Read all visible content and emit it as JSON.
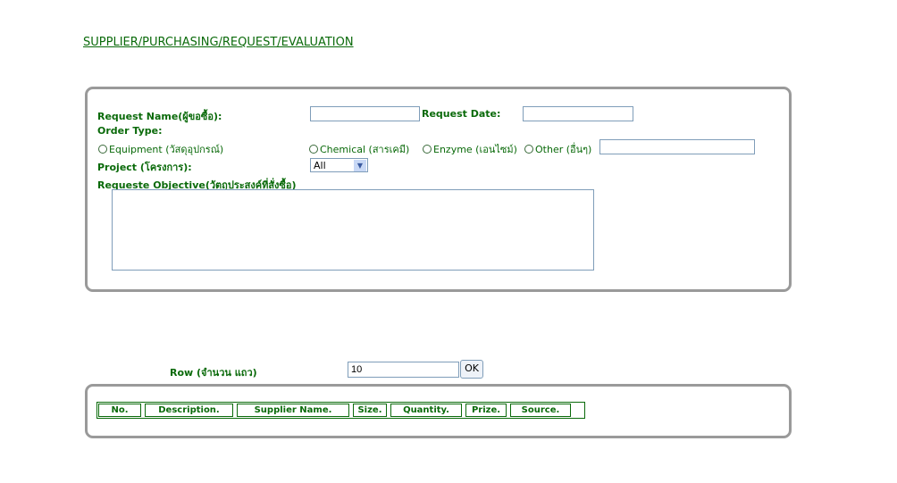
{
  "title": "SUPPLIER/PURCHASING/REQUEST/EVALUATION",
  "form": {
    "request_name_label": "Request Name(ผู้ขอซื้อ):",
    "request_name_value": "",
    "request_date_label": "Request Date:",
    "request_date_value": "",
    "order_type_label": "Order Type:",
    "order_types": [
      "Equipment (วัสดุอุปกรณ์)",
      "Chemical (สารเคมี)",
      "Enzyme (เอนไซม์)",
      "Other (อื่นๆ)"
    ],
    "other_value": "",
    "project_label": "Project (โครงการ):",
    "project_selected": "All",
    "objective_label": "Requeste Objective(วัตถุประสงค์ที่สั่งซื้อ)",
    "objective_value": ""
  },
  "rows": {
    "label": "Row (จำนวน แถว)",
    "value": "10",
    "ok_label": "OK"
  },
  "table": {
    "columns": [
      "No.",
      "Description.",
      "Supplier Name.",
      "Size.",
      "Quantity.",
      "Prize.",
      "Source."
    ]
  }
}
